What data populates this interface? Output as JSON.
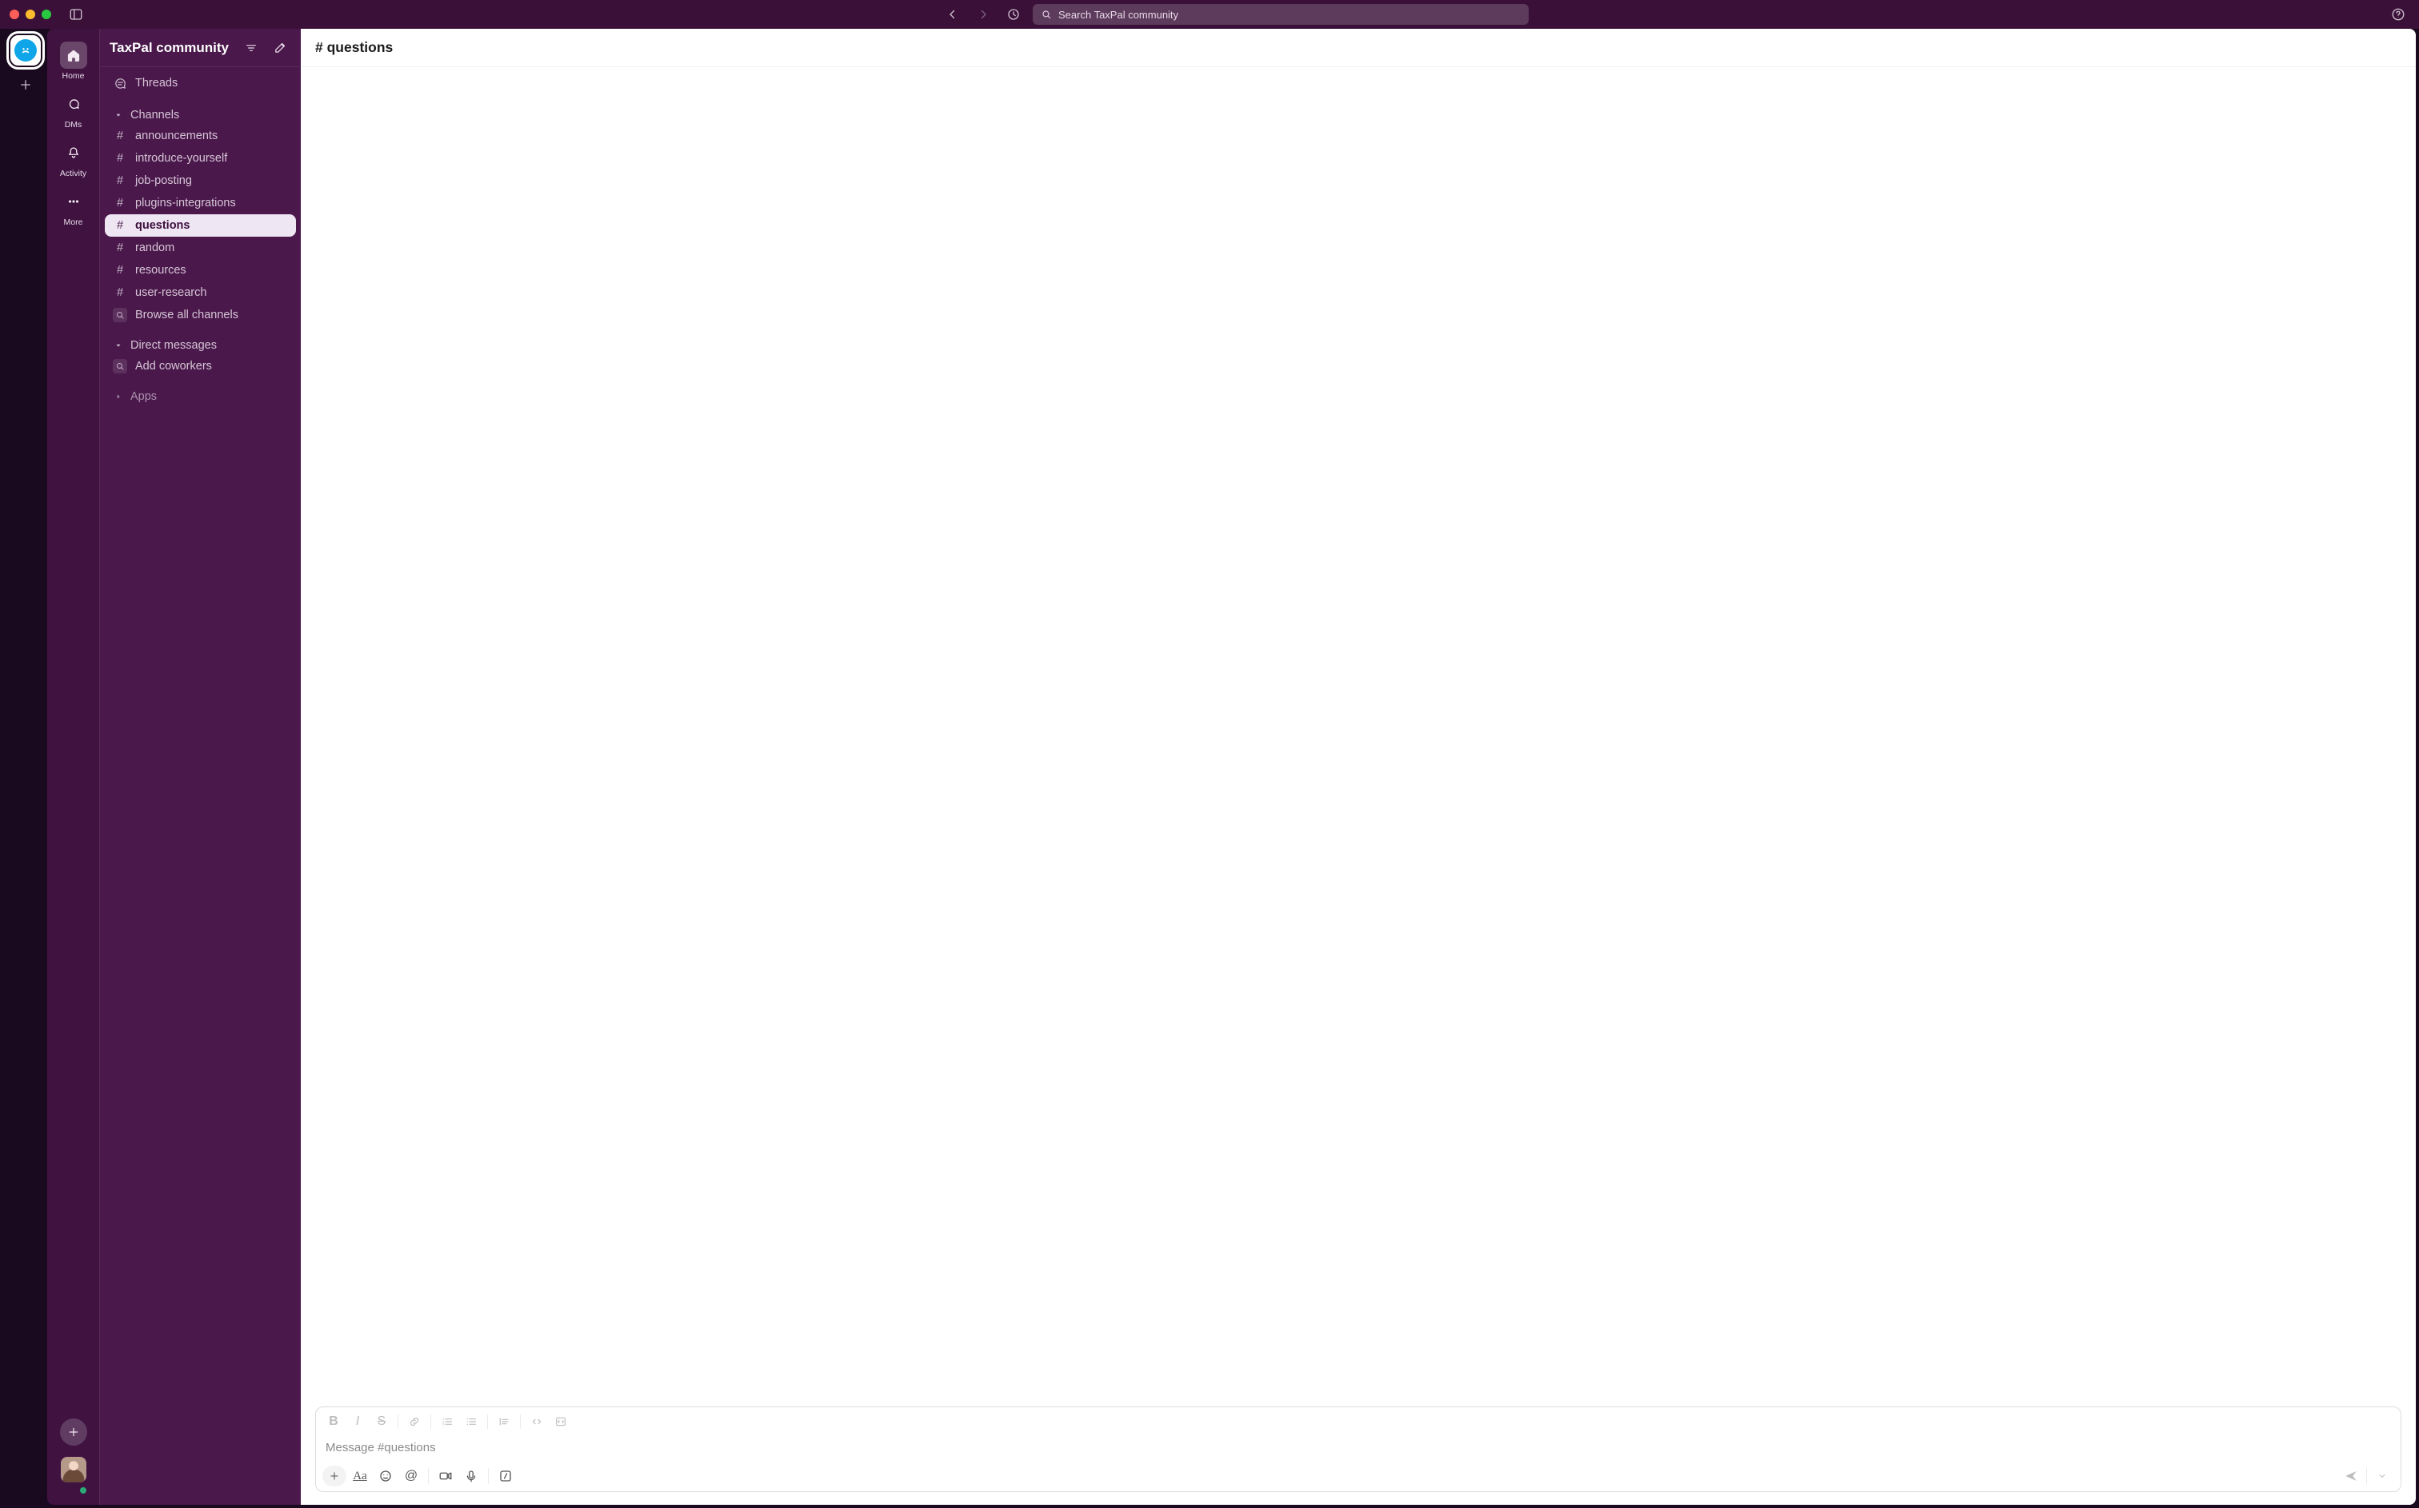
{
  "workspace": {
    "name": "TaxPal community"
  },
  "titlebar": {
    "search_placeholder": "Search TaxPal community"
  },
  "rail": {
    "items": [
      {
        "label": "Home",
        "icon": "home-icon",
        "active": true
      },
      {
        "label": "DMs",
        "icon": "dms-icon",
        "active": false
      },
      {
        "label": "Activity",
        "icon": "activity-icon",
        "active": false
      },
      {
        "label": "More",
        "icon": "more-icon",
        "active": false
      }
    ]
  },
  "sidebar": {
    "threads_label": "Threads",
    "channels_label": "Channels",
    "dms_label": "Direct messages",
    "apps_label": "Apps",
    "browse_label": "Browse all channels",
    "add_coworkers_label": "Add coworkers",
    "channels": [
      {
        "name": "announcements",
        "selected": false
      },
      {
        "name": "introduce-yourself",
        "selected": false
      },
      {
        "name": "job-posting",
        "selected": false
      },
      {
        "name": "plugins-integrations",
        "selected": false
      },
      {
        "name": "questions",
        "selected": true
      },
      {
        "name": "random",
        "selected": false
      },
      {
        "name": "resources",
        "selected": false
      },
      {
        "name": "user-research",
        "selected": false
      }
    ]
  },
  "channel": {
    "name": "questions",
    "header": "# questions"
  },
  "composer": {
    "placeholder": "Message #questions"
  }
}
